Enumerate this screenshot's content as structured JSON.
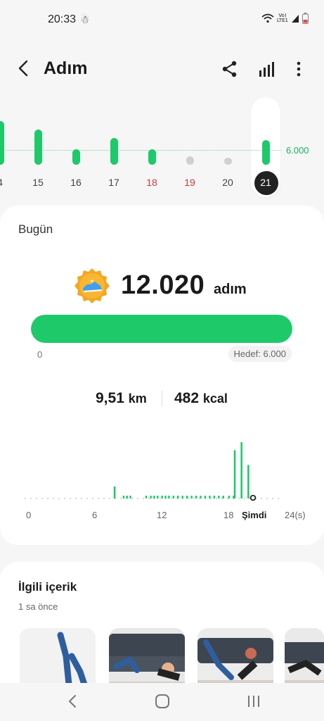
{
  "status": {
    "time": "20:33",
    "user_glyph": "☃",
    "network_top": "Vo)",
    "network_bottom": "LTE1"
  },
  "header": {
    "title": "Adım"
  },
  "icons": {
    "back": "back-icon",
    "share": "share-icon",
    "stats": "stats-icon",
    "more": "more-icon",
    "badge": "shoe-badge-icon",
    "nav_back": "nav-back-icon",
    "nav_home": "nav-home-icon",
    "nav_recent": "nav-recent-icon"
  },
  "week": {
    "goal_label": "6.000",
    "days": [
      {
        "label": "4",
        "weekend": false
      },
      {
        "label": "15",
        "weekend": false
      },
      {
        "label": "16",
        "weekend": false
      },
      {
        "label": "17",
        "weekend": false
      },
      {
        "label": "18",
        "weekend": true
      },
      {
        "label": "19",
        "weekend": true
      },
      {
        "label": "20",
        "weekend": false
      },
      {
        "label": "21",
        "weekend": false
      }
    ]
  },
  "today": {
    "label": "Bugün",
    "steps": "12.020",
    "unit": "adım",
    "progress_percent": 100,
    "min_label": "0",
    "goal_label": "Hedef: 6.000",
    "distance_value": "9,51",
    "distance_unit": "km",
    "kcal_value": "482",
    "kcal_unit": "kcal"
  },
  "hourly": {
    "ticks": [
      "0",
      "6",
      "12",
      "18",
      "24(s)"
    ],
    "now_label": "Şimdi"
  },
  "related": {
    "title": "İlgili içerik",
    "time": "1 sa önce"
  },
  "colors": {
    "accent": "#1ec96a",
    "weekend": "#cc3a3a",
    "dark": "#222222"
  },
  "chart_data": [
    {
      "type": "bar",
      "categories": [
        "4",
        "15",
        "16",
        "17",
        "18",
        "19",
        "20",
        "21"
      ],
      "values": [
        10500,
        8500,
        3800,
        6500,
        3800,
        0,
        0,
        6000
      ],
      "reference_line": 6000
    },
    {
      "type": "bar",
      "x": [
        9,
        18,
        19,
        20
      ],
      "values": [
        900,
        3600,
        4200,
        2500
      ],
      "x_ticks": [
        "0",
        "6",
        "12",
        "18",
        "24(s)"
      ]
    }
  ]
}
